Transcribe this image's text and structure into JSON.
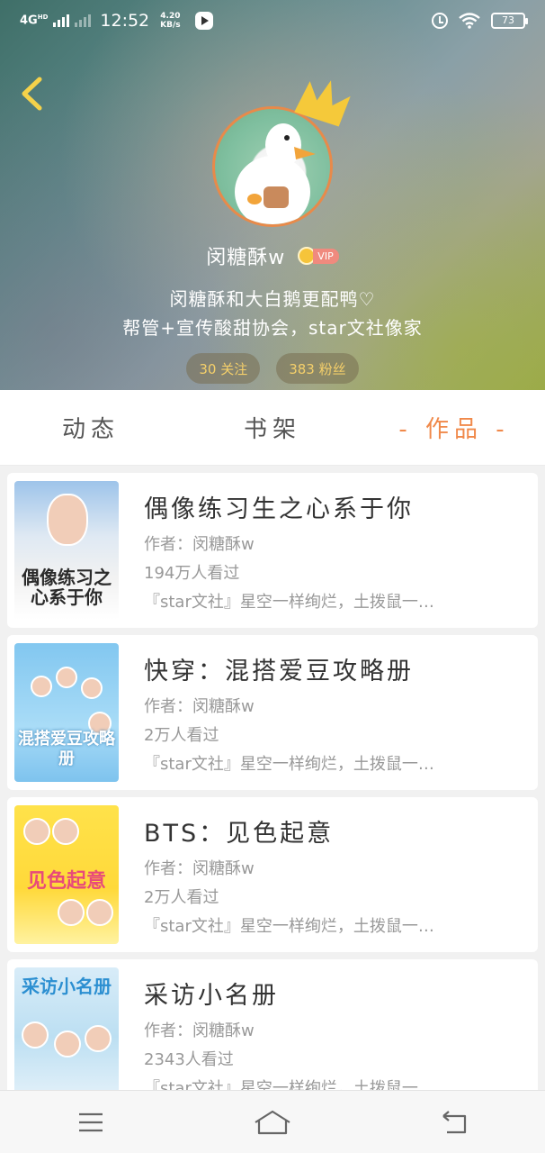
{
  "status_bar": {
    "network": "4G",
    "network_sub": "HD",
    "time": "12:52",
    "speed_value": "4.20",
    "speed_unit": "KB/s",
    "battery": "73"
  },
  "profile": {
    "nickname": "闵糖酥w",
    "vip_label": "VIP",
    "bio_line1": "闵糖酥和大白鹅更配鸭♡",
    "bio_line2": "帮管+宣传酸甜协会，star文社像家",
    "following": "30 关注",
    "followers": "383 粉丝"
  },
  "tabs": [
    {
      "label": "动态",
      "active": false
    },
    {
      "label": "书架",
      "active": false
    },
    {
      "label": "- 作品 -",
      "active": true
    }
  ],
  "works": [
    {
      "cover_text": "偶像练习之心系于你",
      "title": "偶像练习生之心系于你",
      "author": "作者：闵糖酥w",
      "views": "194万人看过",
      "desc": "『star文社』星空一样绚烂，土拨鼠一…"
    },
    {
      "cover_text": "混搭爱豆攻略册",
      "title": "快穿：混搭爱豆攻略册",
      "author": "作者：闵糖酥w",
      "views": "2万人看过",
      "desc": "『star文社』星空一样绚烂，土拨鼠一…"
    },
    {
      "cover_text": "见色起意",
      "title": "BTS：见色起意",
      "author": "作者：闵糖酥w",
      "views": "2万人看过",
      "desc": "『star文社』星空一样绚烂，土拨鼠一…"
    },
    {
      "cover_text": "采访小名册",
      "title": "采访小名册",
      "author": "作者：闵糖酥w",
      "views": "2343人看过",
      "desc": "『star文社』星空一样绚烂，土拨鼠一…"
    }
  ],
  "colors": {
    "accent": "#f0894a",
    "stat_text": "#f4cf6a",
    "vip_badge": "#f08a7e"
  },
  "icons": {
    "back": "chevron-left-icon",
    "menu": "menu-icon",
    "home": "home-icon",
    "return": "back-return-icon"
  }
}
